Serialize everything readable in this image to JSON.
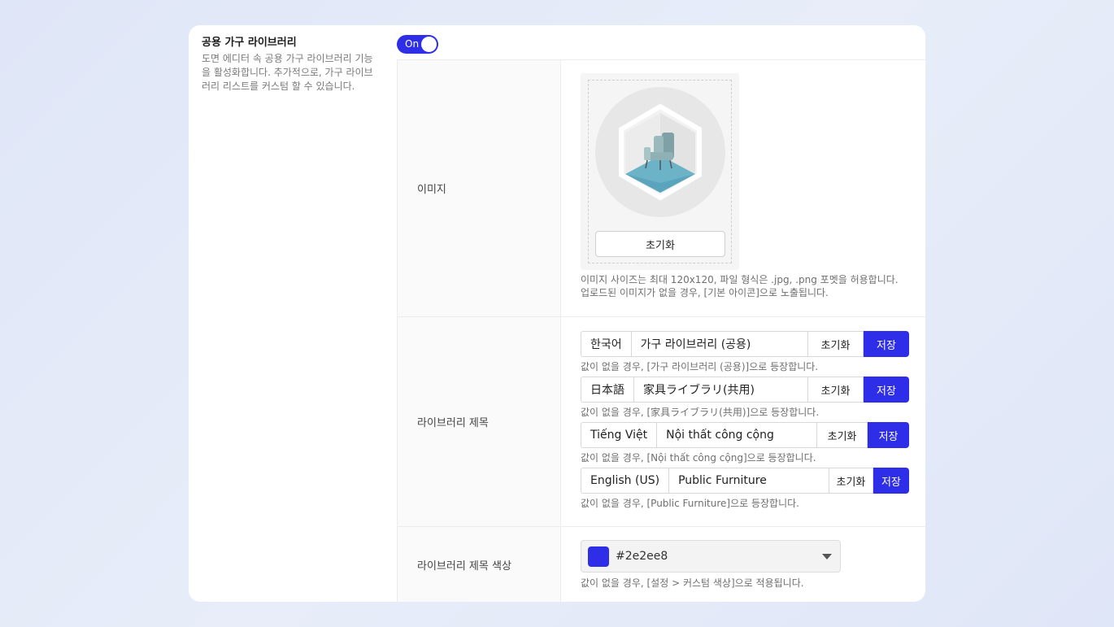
{
  "section": {
    "title": "공용 가구 라이브러리",
    "description": "도면 에디터 속 공용 가구 라이브러리 기능을 활성화합니다. 추가적으로, 가구 라이브러리 리스트를 커스텀 할 수 있습니다.",
    "toggle_label": "On",
    "toggle_state": true
  },
  "image_row": {
    "label": "이미지",
    "icon": "furniture-armchair-icon",
    "reset_label": "초기화",
    "help_line1": "이미지 사이즈는 최대 120x120, 파일 형식은 .jpg, .png 포멧을 허용합니다.",
    "help_line2": "업로드된 이미지가 없을 경우, [기본 아이콘]으로 노출됩니다."
  },
  "title_row": {
    "label": "라이브러리 제목",
    "languages": [
      {
        "lang": "한국어",
        "value": "가구 라이브러리 (공용)",
        "reset": "초기화",
        "save": "저장",
        "hint": "값이 없을 경우, [가구 라이브러리 (공용)]으로 등장합니다."
      },
      {
        "lang": "日本語",
        "value": "家具ライブラリ(共用)",
        "reset": "초기화",
        "save": "저장",
        "hint": "값이 없을 경우, [家具ライブラリ(共用)]으로 등장합니다."
      },
      {
        "lang": "Tiếng Việt",
        "value": "Nội thất công cộng",
        "reset": "초기화",
        "save": "저장",
        "hint": "값이 없을 경우, [Nội thất công cộng]으로 등장합니다."
      },
      {
        "lang": "English (US)",
        "value": "Public Furniture",
        "reset": "초기화",
        "save": "저장",
        "hint": "값이 없을 경우, [Public Furniture]으로 등장합니다."
      }
    ]
  },
  "color_row": {
    "label": "라이브러리 제목 색상",
    "value": "#2e2ee8",
    "swatch_color": "#2e2ee8",
    "hint": "값이 없을 경우, [설정 > 커스텀 색상]으로 적용됩니다."
  },
  "colors": {
    "accent": "#2e2ee8"
  }
}
